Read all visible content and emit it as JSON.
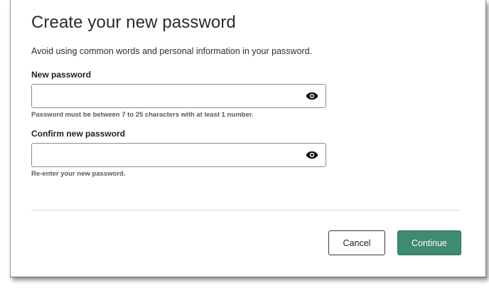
{
  "dialog": {
    "title": "Create your new password",
    "subtitle": "Avoid using common words and personal information in your password."
  },
  "fields": {
    "new_password": {
      "label": "New password",
      "value": "",
      "helper": "Password must be between 7 to 25 characters with at least 1 number.",
      "icon": "eye-icon"
    },
    "confirm_password": {
      "label": "Confirm new password",
      "value": "",
      "helper": "Re-enter your new password.",
      "icon": "eye-icon"
    }
  },
  "actions": {
    "cancel_label": "Cancel",
    "continue_label": "Continue"
  },
  "colors": {
    "primary": "#3f8a72",
    "divider": "#cfe3e3"
  }
}
